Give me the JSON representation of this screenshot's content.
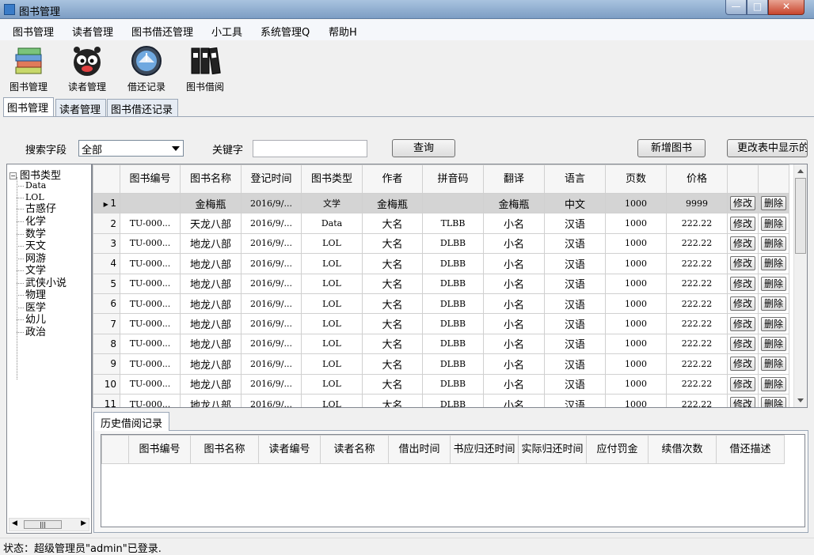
{
  "window": {
    "title": "图书管理"
  },
  "menu": [
    "图书管理",
    "读者管理",
    "图书借还管理",
    "小工具",
    "系统管理Q",
    "帮助H"
  ],
  "toolbar": [
    {
      "label": "图书管理",
      "icon": "books-stack-icon"
    },
    {
      "label": "读者管理",
      "icon": "cartoon-face-icon"
    },
    {
      "label": "借还记录",
      "icon": "clock-icon"
    },
    {
      "label": "图书借阅",
      "icon": "binders-icon"
    }
  ],
  "tabs": [
    "图书管理",
    "读者管理",
    "图书借还记录"
  ],
  "search": {
    "field_label": "搜索字段",
    "field_value": "全部",
    "keyword_label": "关键字",
    "keyword_value": "",
    "query_button": "查询",
    "add_button": "新增图书",
    "columns_button": "更改表中显示的"
  },
  "tree": {
    "root": "图书类型",
    "items": [
      "Data",
      "LOL",
      "古惑仔",
      "化学",
      "数学",
      "天文",
      "网游",
      "文学",
      "武侠小说",
      "物理",
      "医学",
      "幼儿",
      "政治"
    ]
  },
  "grid": {
    "headers": [
      "图书编号",
      "图书名称",
      "登记时间",
      "图书类型",
      "作者",
      "拼音码",
      "翻译",
      "语言",
      "页数",
      "价格"
    ],
    "edit_label": "修改",
    "delete_label": "删除",
    "rows": [
      {
        "num": "1",
        "cells": [
          "",
          "金梅瓶",
          "2016/9/...",
          "文学",
          "金梅瓶",
          "",
          "金梅瓶",
          "中文",
          "1000",
          "9999"
        ]
      },
      {
        "num": "2",
        "cells": [
          "TU-000...",
          "天龙八部",
          "2016/9/...",
          "Data",
          "大名",
          "TLBB",
          "小名",
          "汉语",
          "1000",
          "222.22"
        ]
      },
      {
        "num": "3",
        "cells": [
          "TU-000...",
          "地龙八部",
          "2016/9/...",
          "LOL",
          "大名",
          "DLBB",
          "小名",
          "汉语",
          "1000",
          "222.22"
        ]
      },
      {
        "num": "4",
        "cells": [
          "TU-000...",
          "地龙八部",
          "2016/9/...",
          "LOL",
          "大名",
          "DLBB",
          "小名",
          "汉语",
          "1000",
          "222.22"
        ]
      },
      {
        "num": "5",
        "cells": [
          "TU-000...",
          "地龙八部",
          "2016/9/...",
          "LOL",
          "大名",
          "DLBB",
          "小名",
          "汉语",
          "1000",
          "222.22"
        ]
      },
      {
        "num": "6",
        "cells": [
          "TU-000...",
          "地龙八部",
          "2016/9/...",
          "LOL",
          "大名",
          "DLBB",
          "小名",
          "汉语",
          "1000",
          "222.22"
        ]
      },
      {
        "num": "7",
        "cells": [
          "TU-000...",
          "地龙八部",
          "2016/9/...",
          "LOL",
          "大名",
          "DLBB",
          "小名",
          "汉语",
          "1000",
          "222.22"
        ]
      },
      {
        "num": "8",
        "cells": [
          "TU-000...",
          "地龙八部",
          "2016/9/...",
          "LOL",
          "大名",
          "DLBB",
          "小名",
          "汉语",
          "1000",
          "222.22"
        ]
      },
      {
        "num": "9",
        "cells": [
          "TU-000...",
          "地龙八部",
          "2016/9/...",
          "LOL",
          "大名",
          "DLBB",
          "小名",
          "汉语",
          "1000",
          "222.22"
        ]
      },
      {
        "num": "10",
        "cells": [
          "TU-000...",
          "地龙八部",
          "2016/9/...",
          "LOL",
          "大名",
          "DLBB",
          "小名",
          "汉语",
          "1000",
          "222.22"
        ]
      },
      {
        "num": "11",
        "cells": [
          "TU-000...",
          "地龙八部",
          "2016/9/...",
          "LOL",
          "大名",
          "DLBB",
          "小名",
          "汉语",
          "1000",
          "222.22"
        ]
      }
    ]
  },
  "history": {
    "tab": "历史借阅记录",
    "headers": [
      "图书编号",
      "图书名称",
      "读者编号",
      "读者名称",
      "借出时间",
      "书应归还时间",
      "实际归还时间",
      "应付罚金",
      "续借次数",
      "借还描述"
    ]
  },
  "status": "状态：超级管理员\"admin\"已登录."
}
